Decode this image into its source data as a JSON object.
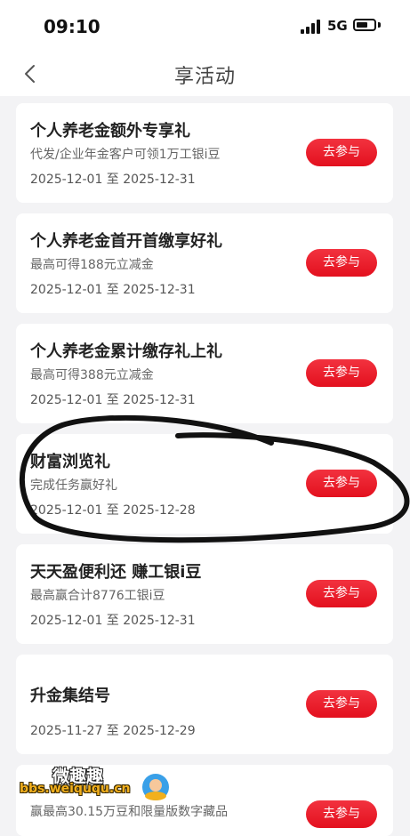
{
  "status_bar": {
    "time": "09:10",
    "network": "5G"
  },
  "nav": {
    "title": "享活动"
  },
  "activities": [
    {
      "title": "个人养老金额外专享礼",
      "desc": "代发/企业年金客户可领1万工银i豆",
      "date": "2025-12-01 至 2025-12-31",
      "button": "去参与"
    },
    {
      "title": "个人养老金首开首缴享好礼",
      "desc": "最高可得188元立减金",
      "date": "2025-12-01 至 2025-12-31",
      "button": "去参与"
    },
    {
      "title": "个人养老金累计缴存礼上礼",
      "desc": "最高可得388元立减金",
      "date": "2025-12-01 至 2025-12-31",
      "button": "去参与"
    },
    {
      "title": "财富浏览礼",
      "desc": "完成任务赢好礼",
      "date": "2025-12-01 至 2025-12-28",
      "button": "去参与"
    },
    {
      "title": "天天盈便利还 赚工银i豆",
      "desc": "最高赢合计8776工银i豆",
      "date": "2025-12-01 至 2025-12-31",
      "button": "去参与"
    },
    {
      "title": "升金集结号",
      "desc": "",
      "date": "2025-11-27 至 2025-12-29",
      "button": "去参与"
    },
    {
      "title": "",
      "desc": "赢最高30.15万豆和限量版数字藏品",
      "date": "",
      "button": "去参与"
    }
  ],
  "watermark": {
    "logo_text": "微趣趣",
    "url": "bbs.weiququ.cn"
  },
  "colors": {
    "accent": "#e8192c",
    "background": "#f3f3f5",
    "card": "#ffffff"
  }
}
